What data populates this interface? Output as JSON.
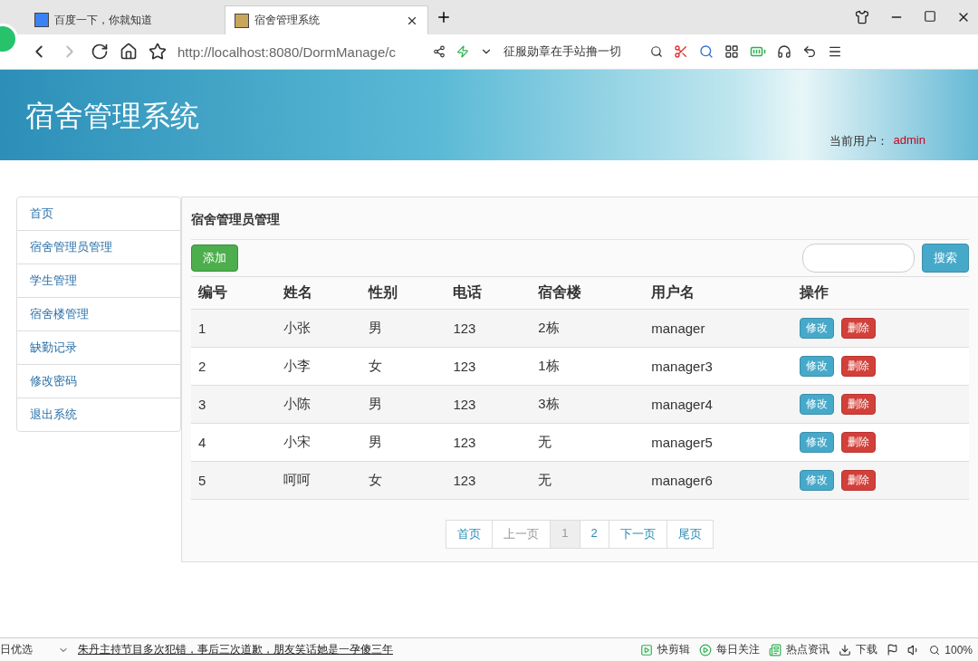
{
  "browser": {
    "tabs": [
      {
        "title": "百度一下，你就知道",
        "selected": false
      },
      {
        "title": "宿舍管理系统",
        "selected": true
      }
    ],
    "address": "http://localhost:8080/DormManage/c",
    "search_text": "征服勋章在手站撸一切"
  },
  "header": {
    "title": "宿舍管理系统",
    "user_label": "当前用户：",
    "user": "admin"
  },
  "sidebar": {
    "items": [
      "首页",
      "宿舍管理员管理",
      "学生管理",
      "宿舍楼管理",
      "缺勤记录",
      "修改密码",
      "退出系统"
    ]
  },
  "panel": {
    "title": "宿舍管理员管理",
    "add_button": "添加",
    "search_button": "搜索",
    "table": {
      "columns": [
        "编号",
        "姓名",
        "性别",
        "电话",
        "宿舍楼",
        "用户名",
        "操作"
      ],
      "rows": [
        {
          "cells": [
            "1",
            "小张",
            "男",
            "123",
            "2栋",
            "manager"
          ],
          "actions": [
            "修改",
            "删除"
          ]
        },
        {
          "cells": [
            "2",
            "小李",
            "女",
            "123",
            "1栋",
            "manager3"
          ],
          "actions": [
            "修改",
            "删除"
          ]
        },
        {
          "cells": [
            "3",
            "小陈",
            "男",
            "123",
            "3栋",
            "manager4"
          ],
          "actions": [
            "修改",
            "删除"
          ]
        },
        {
          "cells": [
            "4",
            "小宋",
            "男",
            "123",
            "无",
            "manager5"
          ],
          "actions": [
            "修改",
            "删除"
          ]
        },
        {
          "cells": [
            "5",
            "呵呵",
            "女",
            "123",
            "无",
            "manager6"
          ],
          "actions": [
            "修改",
            "删除"
          ]
        }
      ]
    },
    "pagination": [
      {
        "label": "首页",
        "disabled": false,
        "selected": false
      },
      {
        "label": "上一页",
        "disabled": true,
        "selected": false
      },
      {
        "label": "1",
        "disabled": false,
        "selected": true
      },
      {
        "label": "2",
        "disabled": false,
        "selected": false
      },
      {
        "label": "下一页",
        "disabled": false,
        "selected": false
      },
      {
        "label": "尾页",
        "disabled": false,
        "selected": false
      }
    ]
  },
  "status_bar": {
    "left": "日优选",
    "news": "朱丹主持节目多次犯错，事后三次道歉，朋友笑话她是一孕傻三年",
    "items": [
      {
        "kind": "clip",
        "label": "快剪辑"
      },
      {
        "kind": "play",
        "label": "每日关注"
      },
      {
        "kind": "news",
        "label": "热点资讯"
      },
      {
        "kind": "download",
        "label": "下载"
      }
    ],
    "zoom": "100%"
  }
}
